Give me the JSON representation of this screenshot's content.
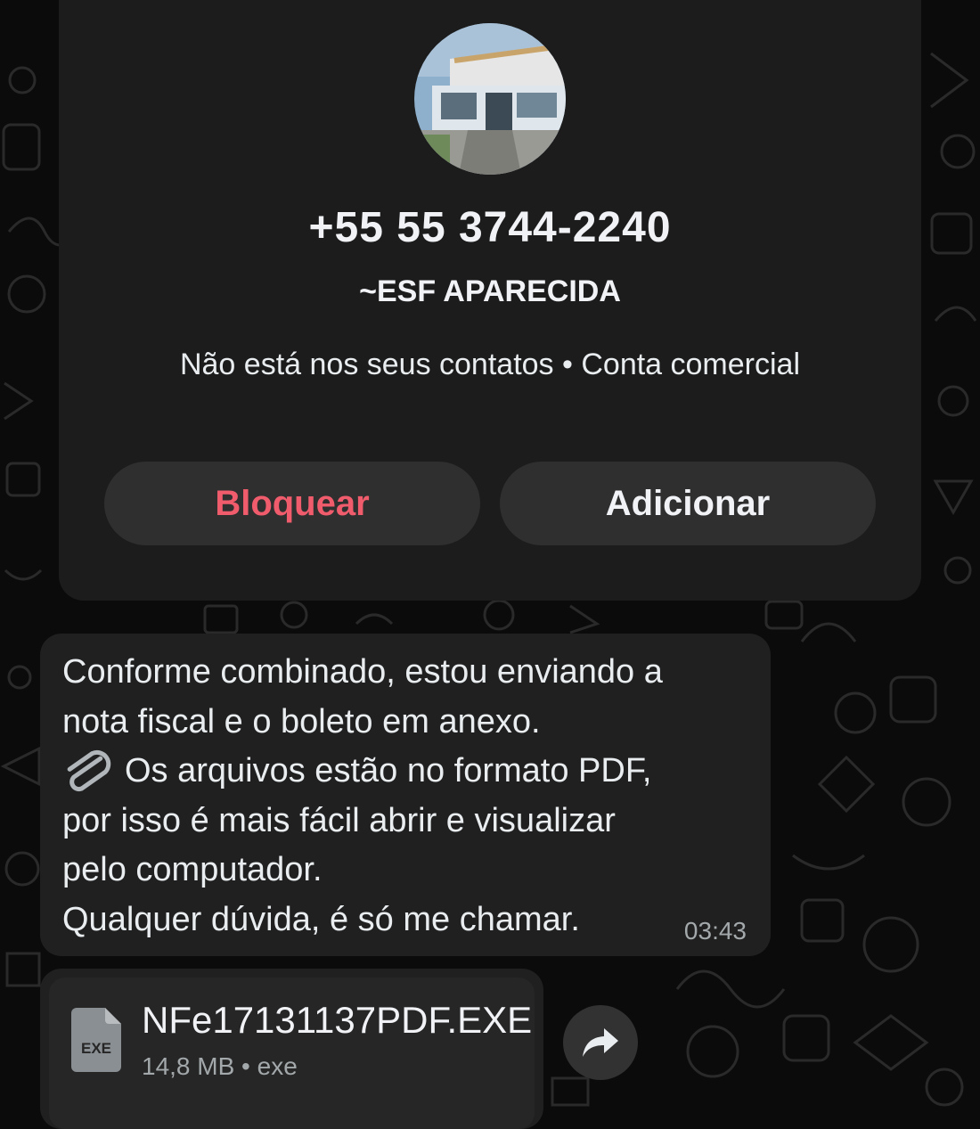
{
  "contact": {
    "phone": "+55 55 3744-2240",
    "push_name": "~ESF APARECIDA",
    "info": "Não está nos seus contatos • Conta comercial",
    "avatar_icon": "building-photo-avatar"
  },
  "actions": {
    "block_label": "Bloquear",
    "add_label": "Adicionar"
  },
  "message": {
    "lines": [
      "Conforme combinado, estou enviando a",
      "nota fiscal e o boleto em anexo.",
      "Os arquivos estão no formato PDF,",
      "por isso é mais fácil abrir e visualizar",
      "pelo computador.",
      "Qualquer dúvida, é só me chamar."
    ],
    "time": "03:43",
    "emoji_icon": "paperclip-icon"
  },
  "attachment": {
    "icon_label": "EXE",
    "file_name": "NFe17131137PDF.EXE",
    "meta": "14,8 MB • exe",
    "forward_icon": "forward-arrow-icon"
  },
  "colors": {
    "block": "#f15c6d",
    "card": "#1c1c1c",
    "bubble": "#202020",
    "button": "#2f2f2f",
    "background": "#0b0b0b"
  }
}
